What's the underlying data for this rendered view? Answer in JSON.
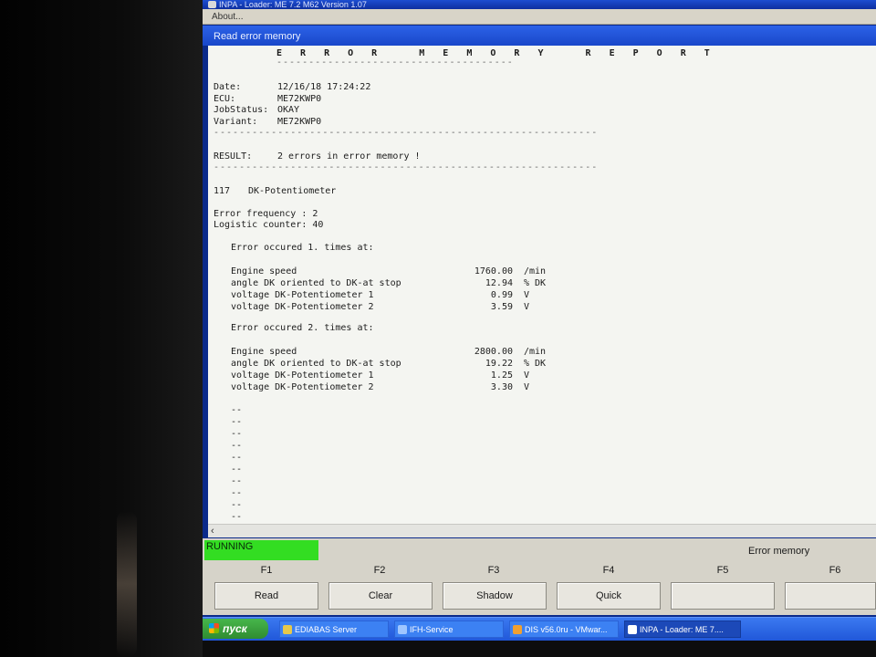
{
  "window": {
    "title": "INPA - Loader:  ME 7.2 M62 Version 1.07",
    "menu_about": "About..."
  },
  "panel_title": "Read error memory",
  "report": {
    "title": "E R R O R   M E M O R Y   R E P O R T",
    "title_underline": "-------------------------------------",
    "date_label": "Date:",
    "date_value": "12/16/18 17:24:22",
    "ecu_label": "ECU:",
    "ecu_value": "ME72KWP0",
    "jobstatus_label": "JobStatus:",
    "jobstatus_value": "OKAY",
    "variant_label": "Variant:",
    "variant_value": "ME72KWP0",
    "separator": "------------------------------------------------------------",
    "result_label": "RESULT:",
    "result_value": "2 errors in error memory !",
    "fault_code": "117",
    "fault_name": "DK-Potentiometer",
    "freq_label": "Error frequency : ",
    "freq_value": "2",
    "logistic_label": "Logistic counter: ",
    "logistic_value": "40",
    "occurrences": [
      {
        "heading": "Error occured 1. times at:",
        "rows": [
          {
            "name": "Engine speed",
            "value": "1760.00",
            "unit": "/min"
          },
          {
            "name": "angle DK oriented to DK-at stop",
            "value": "12.94",
            "unit": "% DK"
          },
          {
            "name": "voltage DK-Potentiometer 1",
            "value": "0.99",
            "unit": "V"
          },
          {
            "name": "voltage DK-Potentiometer 2",
            "value": "3.59",
            "unit": "V"
          }
        ]
      },
      {
        "heading": "Error occured 2. times at:",
        "rows": [
          {
            "name": "Engine speed",
            "value": "2800.00",
            "unit": "/min"
          },
          {
            "name": "angle DK oriented to DK-at stop",
            "value": "19.22",
            "unit": "% DK"
          },
          {
            "name": "voltage DK-Potentiometer 1",
            "value": "1.25",
            "unit": "V"
          },
          {
            "name": "voltage DK-Potentiometer 2",
            "value": "3.30",
            "unit": "V"
          }
        ]
      }
    ],
    "placeholder_lines": [
      "--",
      "--",
      "--",
      "--",
      "--",
      "--",
      "--",
      "--",
      "--",
      "--"
    ]
  },
  "status": {
    "running": "RUNNING",
    "right": "Error memory",
    "running_color": "#33dd22"
  },
  "fkeys": {
    "labels": [
      "F1",
      "F2",
      "F3",
      "F4",
      "F5",
      "F6"
    ],
    "buttons": [
      "Read",
      "Clear",
      "Shadow",
      "Quick",
      "",
      ""
    ]
  },
  "taskbar": {
    "start": "пуск",
    "items": [
      {
        "label": "EDIABAS Server",
        "icon": "ediabas-icon"
      },
      {
        "label": "IFH-Service",
        "icon": "ifh-service-icon"
      },
      {
        "label": "DIS v56.0ru - VMwar...",
        "icon": "vmware-icon"
      },
      {
        "label": "INPA - Loader:  ME 7....",
        "icon": "inpa-icon"
      }
    ]
  }
}
